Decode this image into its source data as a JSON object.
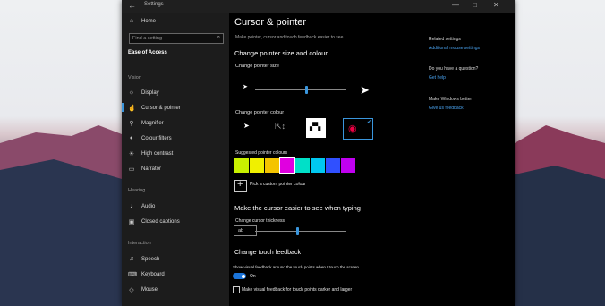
{
  "window": {
    "title": "Settings",
    "back": "←",
    "minimize": "—",
    "maximize": "□",
    "close": "✕"
  },
  "sidebar": {
    "home": "Home",
    "search_placeholder": "Find a setting",
    "category": "Ease of Access",
    "sections": [
      {
        "heading": "Vision",
        "items": [
          "Display",
          "Cursor & pointer",
          "Magnifier",
          "Colour filters",
          "High contrast",
          "Narrator"
        ]
      },
      {
        "heading": "Hearing",
        "items": [
          "Audio",
          "Closed captions"
        ]
      },
      {
        "heading": "Interaction",
        "items": [
          "Speech",
          "Keyboard",
          "Mouse"
        ]
      }
    ]
  },
  "main": {
    "title": "Cursor & pointer",
    "subtitle": "Make pointer, cursor and touch feedback easier to see.",
    "size_heading": "Change pointer size and colour",
    "size_label": "Change pointer size",
    "size_level": 0.55,
    "colour_label": "Change pointer colour",
    "suggested_label": "Suggested pointer colours",
    "suggested_colours": [
      "#c8f000",
      "#f0f000",
      "#f4c400",
      "#e000e0",
      "#00e0c8",
      "#00c8f0",
      "#3050ff",
      "#c000f0"
    ],
    "custom_colour_label": "Pick a custom pointer colour",
    "cursor_heading": "Make the cursor easier to see when typing",
    "thickness_label": "Change cursor thickness",
    "thickness_preview": "ab",
    "thickness_level": 0.45,
    "touch_heading": "Change touch feedback",
    "touch_show_label": "Show visual feedback around the touch points when I touch the screen",
    "toggle_state": "On",
    "darker_label": "Make visual feedback for touch points darker and larger"
  },
  "related": {
    "heading": "Related settings",
    "link": "Additional mouse settings",
    "question": "Do you have a question?",
    "help": "Get help",
    "better": "Make Windows better",
    "feedback": "Give us feedback"
  },
  "colors": {
    "accent": "#3a96dd",
    "link": "#4aa3f0"
  }
}
